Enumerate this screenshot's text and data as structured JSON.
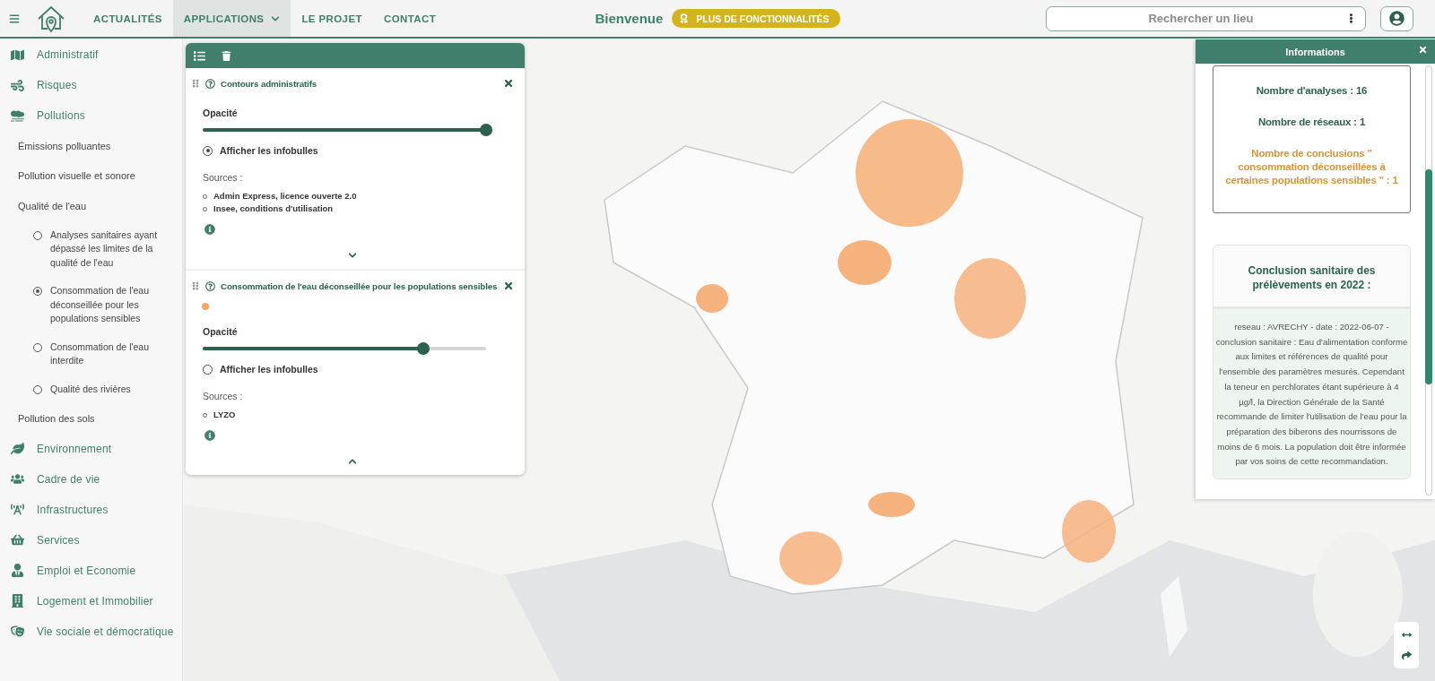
{
  "header": {
    "nav": [
      {
        "label": "ACTUALITÉS",
        "selected": false,
        "dropdown": false
      },
      {
        "label": "APPLICATIONS",
        "selected": true,
        "dropdown": true
      },
      {
        "label": "LE PROJET",
        "selected": false,
        "dropdown": false
      },
      {
        "label": "CONTACT",
        "selected": false,
        "dropdown": false
      }
    ],
    "welcome": "Bienvenue",
    "badge": "PLUS DE FONCTIONNALITÉS",
    "search": {
      "placeholder": "Rechercher un lieu"
    }
  },
  "sidebar": {
    "items": [
      {
        "label": "Administratif",
        "kind": "category"
      },
      {
        "label": "Risques",
        "kind": "category"
      },
      {
        "label": "Pollutions",
        "kind": "category",
        "children": [
          {
            "label": "Émissions polluantes",
            "kind": "subcategory"
          },
          {
            "label": "Pollution visuelle et sonore",
            "kind": "subcategory"
          },
          {
            "label": "Qualité de l'eau",
            "kind": "subcategory",
            "children": [
              {
                "label": "Analyses sanitaires ayant dépassé les limites de la qualité de l'eau",
                "kind": "layer",
                "selected": false
              },
              {
                "label": "Consommation de l'eau déconseillée pour les populations sensibles",
                "kind": "layer",
                "selected": true
              },
              {
                "label": "Consommation de l'eau interdite",
                "kind": "layer",
                "selected": false
              },
              {
                "label": "Qualité des rivières",
                "kind": "layer",
                "selected": false
              }
            ]
          },
          {
            "label": "Pollution des sols",
            "kind": "subcategory"
          }
        ]
      },
      {
        "label": "Environnement",
        "kind": "category"
      },
      {
        "label": "Cadre de vie",
        "kind": "category"
      },
      {
        "label": "Infrastructures",
        "kind": "category"
      },
      {
        "label": "Services",
        "kind": "category"
      },
      {
        "label": "Emploi et Economie",
        "kind": "category"
      },
      {
        "label": "Logement et Immobilier",
        "kind": "category"
      },
      {
        "label": "Vie sociale et démocratique",
        "kind": "category"
      }
    ]
  },
  "layer_panel": {
    "layers": [
      {
        "title": "Contours administratifs",
        "opacity_label": "Opacité",
        "level": 1.0,
        "tooltip_label": "Afficher les infobulles",
        "tooltips_on": true,
        "sources_label": "Sources :",
        "sources": [
          "Admin Express, licence ouverte 2.0",
          "Insee, conditions d'utilisation"
        ],
        "expanded": false
      },
      {
        "title": "Consommation de l'eau déconseillée pour les populations sensibles",
        "color": "#f5a766",
        "opacity_label": "Opacité",
        "level": 0.78,
        "tooltip_label": "Afficher les infobulles",
        "tooltips_on": false,
        "sources_label": "Sources :",
        "sources": [
          "LYZO"
        ],
        "expanded": true
      }
    ]
  },
  "info_panel": {
    "title": "Informations",
    "stats": [
      {
        "text": "Nombre d'analyses : 16",
        "highlight": false
      },
      {
        "text": "Nombre de réseaux : 1",
        "highlight": false
      },
      {
        "text": "Nombre de conclusions \" consommation déconseillées à certaines populations sensibles \" : 1",
        "highlight": true
      }
    ],
    "conclusion_title": "Conclusion sanitaire des prélèvements en 2022 :",
    "conclusion_text": "reseau : AVRECHY - date : 2022-06-07 - conclusion sanitaire : Eau d'alimentation conforme aux limites et références de qualité pour l'ensemble des paramètres mesurés. Cependant la teneur en perchlorates étant supérieure à 4 µg/l, la Direction Générale de la Santé recommande de limiter l'utilisation de l'eau pour la préparation des biberons des nourrissons de moins de 6 mois. La population doit être informée par vos soins de cette recommandation."
  }
}
